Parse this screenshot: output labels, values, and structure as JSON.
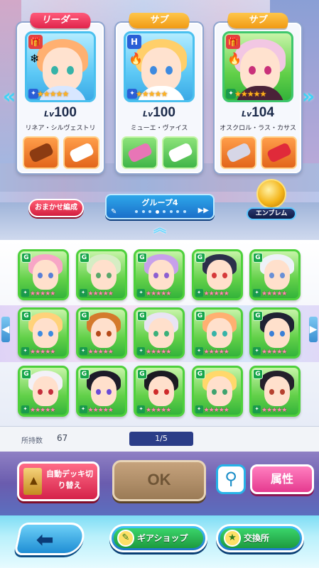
{
  "team": [
    {
      "slot_label": "リーダー",
      "level_prefix": "Lv",
      "level": "100",
      "name": "リネア・シルヴェストリ",
      "hair": "#ffb071",
      "eye": "#36b3a8",
      "outfit": "#d8e7ff",
      "portrait_corner": "🎁",
      "element_icon": "snowflake-icon"
    },
    {
      "slot_label": "サブ",
      "level_prefix": "Lv",
      "level": "100",
      "name": "ミューエ・ヴァイス",
      "hair": "#ffcf6a",
      "eye": "#3d8ae0",
      "outfit": "#ffffff",
      "portrait_corner": "H",
      "element_icon": "flame-icon"
    },
    {
      "slot_label": "サブ",
      "level_prefix": "Lv",
      "level": "104",
      "name": "オスクロル・ラス・カサス",
      "hair": "#f2c7e3",
      "eye": "#c9307a",
      "outfit": "#4a2238",
      "portrait_corner": "🎁",
      "element_icon": "flame-icon"
    }
  ],
  "buttons": {
    "omakase": "おまかせ編成",
    "emblem": "エンブレム",
    "auto_deck": "自動デッキ切り替え",
    "ok": "OK",
    "attribute": "属性",
    "gear_shop": "ギアショップ",
    "exchange": "交換所"
  },
  "group": {
    "label": "グループ4",
    "total_pages": 8,
    "current_page": 4
  },
  "roster": [
    {
      "hair": "#f7a6c6",
      "eye": "#5a7fd6"
    },
    {
      "hair": "#d6edc4",
      "eye": "#5aa86a"
    },
    {
      "hair": "#c7a0ea",
      "eye": "#8c5fd1"
    },
    {
      "hair": "#2b2f4a",
      "eye": "#d63a3a"
    },
    {
      "hair": "#eef2f8",
      "eye": "#6a8fd6"
    },
    {
      "hair": "#ffd27a",
      "eye": "#3d8ae0"
    },
    {
      "hair": "#d47a2c",
      "eye": "#b54a1a"
    },
    {
      "hair": "#e9e4f4",
      "eye": "#3bb07a"
    },
    {
      "hair": "#ffb071",
      "eye": "#36b3a8"
    },
    {
      "hair": "#1f2233",
      "eye": "#3a7fd6"
    },
    {
      "hair": "#f3f1f7",
      "eye": "#c42f3c"
    },
    {
      "hair": "#1d1b29",
      "eye": "#6b4bd6"
    },
    {
      "hair": "#1b1b22",
      "eye": "#cf2b2b"
    },
    {
      "hair": "#ffd86b",
      "eye": "#3fa36e"
    },
    {
      "hair": "#24202b",
      "eye": "#b5412f"
    }
  ],
  "info": {
    "owned_label": "所持数",
    "owned_count": "67",
    "page": "1/5"
  },
  "colors": {
    "leader_tag": "#e0244b",
    "sub_tag": "#f09a14",
    "rarity_frame": "#4ed13c",
    "accent_blue": "#1a6fca"
  }
}
